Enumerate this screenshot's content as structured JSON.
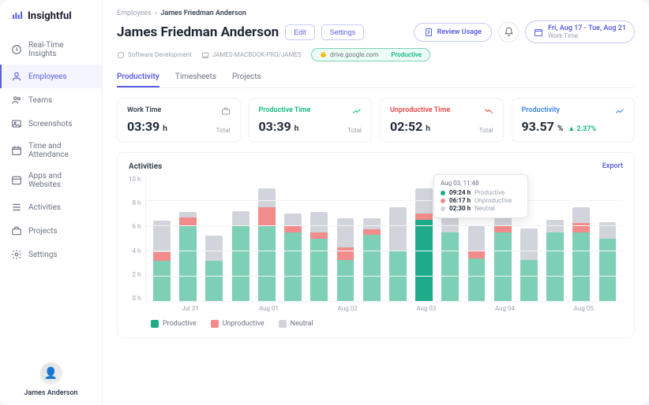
{
  "brand": "Insightful",
  "sidebar": {
    "items": [
      {
        "label": "Real-Time Insights"
      },
      {
        "label": "Employees"
      },
      {
        "label": "Teams"
      },
      {
        "label": "Screenshots"
      },
      {
        "label": "Time and Attendance"
      },
      {
        "label": "Apps and Websites"
      },
      {
        "label": "Activities"
      },
      {
        "label": "Projects"
      },
      {
        "label": "Settings"
      }
    ],
    "user": "James Anderson"
  },
  "crumbs": {
    "a": "Employees",
    "b": "James Friedman Anderson"
  },
  "title": "James Friedman Anderson",
  "actions": {
    "edit": "Edit",
    "settings": "Settings",
    "review": "Review Usage"
  },
  "date_range": {
    "main": "Fri, Aug 17 - Tue, Aug 21",
    "sub": "Work Time"
  },
  "meta": {
    "team": "Software Development",
    "device": "JAMES-MACBOOK-PRO/JAMES",
    "site": "drive.google.com",
    "status": "Productive"
  },
  "tabs": [
    {
      "label": "Productivity"
    },
    {
      "label": "Timesheets"
    },
    {
      "label": "Projects"
    }
  ],
  "cards": {
    "work": {
      "label": "Work Time",
      "value": "03:39",
      "unit": "h",
      "sub": "Total",
      "color": "#374151"
    },
    "prod": {
      "label": "Productive Time",
      "value": "03:39",
      "unit": "h",
      "sub": "Total",
      "color": "#10b981"
    },
    "unprod": {
      "label": "Unproductive Time",
      "value": "02:52",
      "unit": "h",
      "sub": "Total",
      "color": "#ef4444"
    },
    "pct": {
      "label": "Productivity",
      "value": "93.57",
      "unit": "%",
      "delta": "▲ 2.37%",
      "color": "#3b82f6"
    }
  },
  "panel": {
    "title": "Activities",
    "export": "Export"
  },
  "legend": {
    "p": "Productive",
    "u": "Unproductive",
    "n": "Neutral"
  },
  "tooltip": {
    "title": "Aug 03, 11:48",
    "rows": [
      {
        "color": "#1fab89",
        "val": "09:24 h",
        "lab": "Productive"
      },
      {
        "color": "#f28b8b",
        "val": "06:17 h",
        "lab": "Unproductive"
      },
      {
        "color": "#d1d5db",
        "val": "02:30 h",
        "lab": "Neutral"
      }
    ]
  },
  "chart_data": {
    "type": "bar",
    "ylabel": "hours",
    "ylim": [
      0,
      10
    ],
    "y_ticks": [
      "10 h",
      "8 h",
      "6 h",
      "4 h",
      "2 h",
      "0 h"
    ],
    "x_group_labels": [
      "Jul 31",
      "Aug 01",
      "Aug 02",
      "Aug 03",
      "Aug 04",
      "Aug 05"
    ],
    "series_names": [
      "Productive",
      "Unproductive",
      "Neutral"
    ],
    "bars": [
      {
        "p": 3.2,
        "u": 0.7,
        "n": 2.5
      },
      {
        "p": 6.0,
        "u": 0.7,
        "n": 0.4
      },
      {
        "p": 3.2,
        "u": 0.0,
        "n": 2.0
      },
      {
        "p": 6.0,
        "u": 0.0,
        "n": 1.2
      },
      {
        "p": 6.0,
        "u": 1.5,
        "n": 1.5
      },
      {
        "p": 5.5,
        "u": 0.5,
        "n": 1.0
      },
      {
        "p": 5.0,
        "u": 0.5,
        "n": 1.6
      },
      {
        "p": 3.3,
        "u": 1.0,
        "n": 2.3
      },
      {
        "p": 5.3,
        "u": 0.4,
        "n": 0.9
      },
      {
        "p": 4.0,
        "u": 0.0,
        "n": 3.5
      },
      {
        "p": 6.5,
        "u": 0.5,
        "n": 2.0,
        "solid": true
      },
      {
        "p": 5.5,
        "u": 0.0,
        "n": 1.5
      },
      {
        "p": 3.4,
        "u": 0.6,
        "n": 2.0
      },
      {
        "p": 5.5,
        "u": 0.5,
        "n": 1.5
      },
      {
        "p": 3.3,
        "u": 0.0,
        "n": 2.5
      },
      {
        "p": 5.5,
        "u": 0.0,
        "n": 1.0
      },
      {
        "p": 5.5,
        "u": 0.7,
        "n": 1.3
      },
      {
        "p": 5.0,
        "u": 0.0,
        "n": 1.3
      }
    ]
  }
}
